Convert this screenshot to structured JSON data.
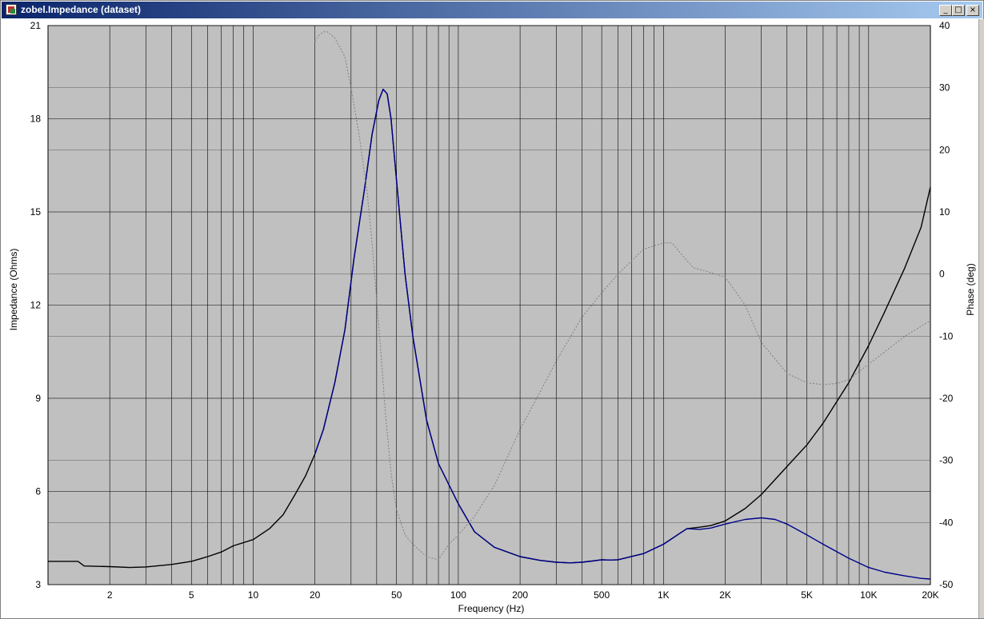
{
  "window": {
    "title": "zobel.Impedance (dataset)"
  },
  "chart_data": {
    "type": "line",
    "xlabel": "Frequency (Hz)",
    "ylabel": "Impedance (Ohms)",
    "y2label": "Phase (deg)",
    "xscale": "log",
    "xlim": [
      1,
      20000
    ],
    "ylim": [
      3,
      21
    ],
    "y2lim": [
      -50,
      40
    ],
    "grid": true,
    "background": "#c0c0c0",
    "xticks": [
      {
        "value": 2,
        "label": "2"
      },
      {
        "value": 5,
        "label": "5"
      },
      {
        "value": 10,
        "label": "10"
      },
      {
        "value": 20,
        "label": "20"
      },
      {
        "value": 50,
        "label": "50"
      },
      {
        "value": 100,
        "label": "100"
      },
      {
        "value": 200,
        "label": "200"
      },
      {
        "value": 500,
        "label": "500"
      },
      {
        "value": 1000,
        "label": "1K"
      },
      {
        "value": 2000,
        "label": "2K"
      },
      {
        "value": 5000,
        "label": "5K"
      },
      {
        "value": 10000,
        "label": "10K"
      },
      {
        "value": 20000,
        "label": "20K"
      }
    ],
    "yticks": [
      3,
      6,
      9,
      12,
      15,
      18,
      21
    ],
    "y2ticks": [
      -50,
      -40,
      -30,
      -20,
      -10,
      0,
      10,
      20,
      30,
      40
    ],
    "series": [
      {
        "color": "#000000",
        "axis": "left",
        "style": "solid",
        "x": [
          1,
          1.4,
          1.5,
          2,
          2.5,
          3,
          4,
          5,
          6,
          7,
          8,
          10,
          12,
          14,
          16,
          18,
          20,
          22,
          25,
          28,
          31,
          35,
          38,
          41,
          43,
          45,
          47,
          50,
          55,
          60,
          70,
          80,
          100,
          120,
          150,
          200,
          250,
          300,
          350,
          400,
          450,
          500,
          550,
          600,
          800,
          1000,
          1200,
          1300,
          1500,
          1700,
          2000,
          2500,
          3000,
          4000,
          5000,
          6000,
          8000,
          10000,
          12000,
          15000,
          18000,
          20000
        ],
        "y": [
          3.75,
          3.75,
          3.6,
          3.58,
          3.55,
          3.57,
          3.65,
          3.75,
          3.9,
          4.05,
          4.25,
          4.45,
          4.8,
          5.25,
          5.9,
          6.5,
          7.2,
          8.0,
          9.5,
          11.2,
          13.5,
          15.8,
          17.5,
          18.6,
          18.95,
          18.8,
          18.0,
          16.0,
          13.0,
          11.0,
          8.3,
          6.9,
          5.6,
          4.7,
          4.2,
          3.9,
          3.78,
          3.72,
          3.7,
          3.72,
          3.76,
          3.8,
          3.79,
          3.8,
          4.0,
          4.3,
          4.65,
          4.8,
          4.85,
          4.9,
          5.05,
          5.45,
          5.9,
          6.8,
          7.5,
          8.2,
          9.5,
          10.7,
          11.8,
          13.2,
          14.5,
          15.8
        ]
      },
      {
        "color": "#00008b",
        "axis": "left",
        "style": "solid",
        "x": [
          20,
          22,
          25,
          28,
          31,
          35,
          38,
          41,
          43,
          45,
          47,
          50,
          55,
          60,
          70,
          80,
          100,
          120,
          150,
          200,
          250,
          300,
          350,
          400,
          450,
          500,
          550,
          600,
          800,
          1000,
          1200,
          1300,
          1500,
          1700,
          2000,
          2500,
          3000,
          3500,
          4000,
          5000,
          6000,
          8000,
          10000,
          12000,
          15000,
          18000,
          20000
        ],
        "y": [
          7.2,
          8.0,
          9.5,
          11.2,
          13.5,
          15.8,
          17.5,
          18.6,
          18.95,
          18.8,
          18.0,
          16.0,
          13.0,
          11.0,
          8.3,
          6.9,
          5.6,
          4.7,
          4.2,
          3.9,
          3.78,
          3.72,
          3.7,
          3.72,
          3.76,
          3.8,
          3.79,
          3.8,
          4.0,
          4.3,
          4.65,
          4.8,
          4.78,
          4.82,
          4.95,
          5.1,
          5.15,
          5.1,
          4.95,
          4.6,
          4.3,
          3.85,
          3.55,
          3.4,
          3.28,
          3.2,
          3.18
        ]
      },
      {
        "color": "#808080",
        "axis": "right",
        "style": "dotted",
        "x": [
          20,
          21,
          22,
          23,
          25,
          28,
          30,
          33,
          36,
          38,
          40,
          42,
          44,
          47,
          50,
          55,
          60,
          70,
          80,
          90,
          100,
          120,
          150,
          200,
          250,
          300,
          400,
          500,
          600,
          800,
          1000,
          1100,
          1200,
          1400,
          1600,
          2000,
          2500,
          3000,
          4000,
          5000,
          6000,
          7000,
          8000,
          10000,
          12000,
          15000,
          20000
        ],
        "y": [
          37.5,
          38.5,
          39,
          39,
          38,
          35,
          30,
          22,
          13,
          5,
          -4,
          -13,
          -22,
          -32,
          -38,
          -42,
          -43.5,
          -45.5,
          -46,
          -43.5,
          -42,
          -39,
          -34,
          -25,
          -19,
          -14,
          -7,
          -3,
          0,
          4,
          5,
          5,
          3.5,
          1,
          0.5,
          -0.5,
          -5,
          -11,
          -16,
          -17.5,
          -17.8,
          -17.6,
          -17,
          -14.5,
          -12.5,
          -10,
          -7.5
        ]
      }
    ]
  }
}
